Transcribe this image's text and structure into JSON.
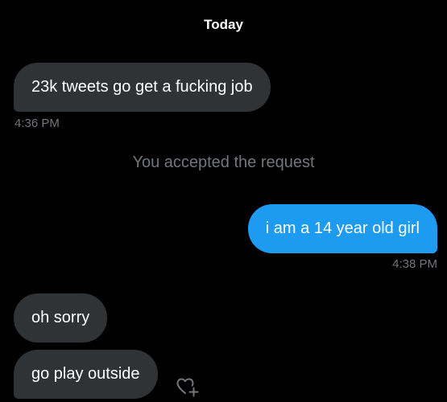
{
  "conversation": {
    "date_header": "Today",
    "messages": [
      {
        "text": "23k tweets go get a fucking job",
        "time": "4:36 PM",
        "direction": "received"
      },
      {
        "text": "i am a 14 year old girl",
        "time": "4:38 PM",
        "direction": "sent"
      },
      {
        "text": "oh sorry",
        "direction": "received"
      },
      {
        "text": "go play outside",
        "direction": "received"
      }
    ],
    "system_message": "You accepted the request"
  },
  "icons": {
    "reaction": "heart-plus-icon"
  },
  "colors": {
    "background": "#000000",
    "received_bubble": "#2f3336",
    "sent_bubble": "#1d9bf0",
    "muted_text": "#71767b"
  }
}
